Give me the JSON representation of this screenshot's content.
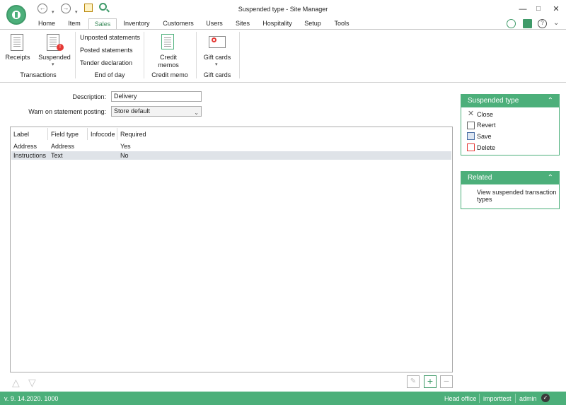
{
  "window": {
    "title": "Suspended type - Site Manager"
  },
  "tabs": [
    "Home",
    "Item",
    "Sales",
    "Inventory",
    "Customers",
    "Users",
    "Sites",
    "Hospitality",
    "Setup",
    "Tools"
  ],
  "ribbon": {
    "receipts_label": "Receipts",
    "suspended_label": "Suspended",
    "transactions_group": "Transactions",
    "end_of_day_items": [
      "Unposted statements",
      "Posted statements",
      "Tender declaration"
    ],
    "end_of_day_group": "End of day",
    "credit_memos_label_1": "Credit",
    "credit_memos_label_2": "memos",
    "credit_memo_group": "Credit memo",
    "gift_cards_label": "Gift cards",
    "gift_cards_group": "Gift cards"
  },
  "form": {
    "description_label": "Description:",
    "description_value": "Delivery",
    "warn_label": "Warn on statement posting:",
    "warn_value": "Store default"
  },
  "grid": {
    "columns": [
      "Label",
      "Field type",
      "Infocode",
      "Required"
    ],
    "rows": [
      {
        "label": "Address",
        "field_type": "Address",
        "infocode": "",
        "required": "Yes"
      },
      {
        "label": "Instructions",
        "field_type": "Text",
        "infocode": "",
        "required": "No"
      }
    ]
  },
  "panels": {
    "suspended_type": {
      "title": "Suspended type",
      "items": [
        "Close",
        "Revert",
        "Save",
        "Delete"
      ]
    },
    "related": {
      "title": "Related",
      "link_line1": "View suspended transaction",
      "link_line2": "types"
    }
  },
  "status": {
    "version": "v. 9. 14.2020. 1000",
    "store": "Head office",
    "database": "importtest",
    "user": "admin"
  },
  "colors": {
    "accent": "#4caf7a",
    "selected_row": "#dfe3e8"
  }
}
